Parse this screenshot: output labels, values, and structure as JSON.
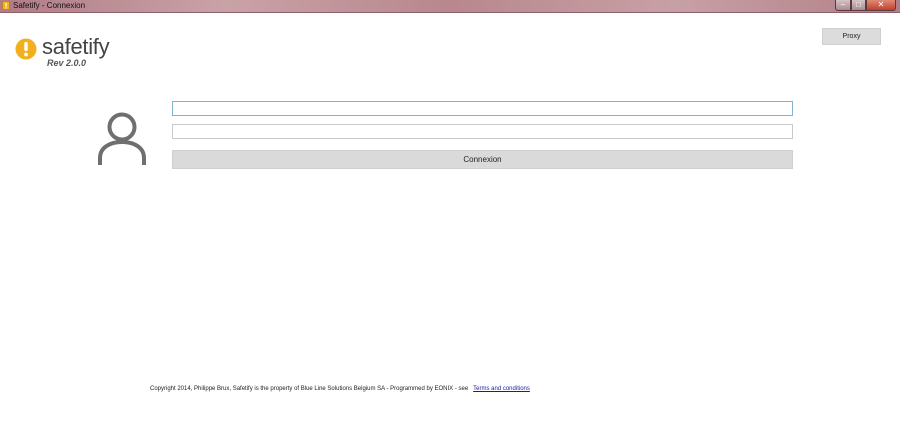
{
  "window": {
    "title": "Safetify - Connexion",
    "controls": {
      "minimize_icon": "minimize-icon",
      "maximize_icon": "maximize-icon",
      "close_icon": "close-icon"
    }
  },
  "logo": {
    "name": "safetify",
    "revision": "Rev 2.0.0",
    "brand_color": "#f2b01e"
  },
  "proxy": {
    "label": "Proxy"
  },
  "login": {
    "avatar_icon": "user-icon",
    "username_value": "",
    "password_value": "",
    "connect_label": "Connexion"
  },
  "footer": {
    "copyright": "Copyright 2014, Philippe Brux, Safetify is the property of Blue Line Solutions Belgium SA - Programmed by EONIX - see",
    "terms_link": "Terms and conditions"
  }
}
